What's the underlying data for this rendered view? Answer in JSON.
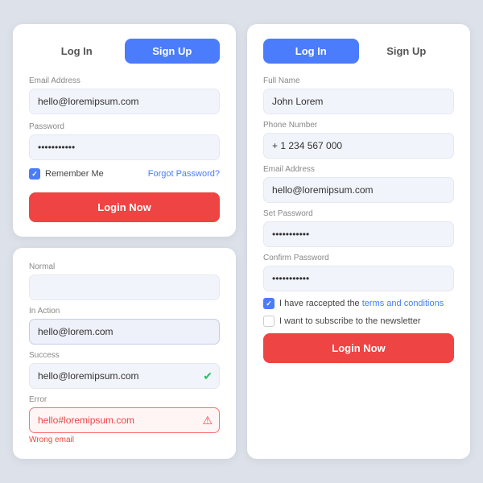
{
  "login_card": {
    "tab_login": "Log In",
    "tab_signup": "Sign Up",
    "email_label": "Email Address",
    "email_value": "hello@loremipsum.com",
    "password_label": "Password",
    "password_value": "••••••••••••",
    "remember_label": "Remember Me",
    "forgot_label": "Forgot Password?",
    "login_button": "Login Now"
  },
  "states_card": {
    "normal_label": "Normal",
    "normal_value": "",
    "inaction_label": "In Action",
    "inaction_value": "hello@lorem.com",
    "success_label": "Success",
    "success_value": "hello@loremipsum.com",
    "error_label": "Error",
    "error_value": "hello#loremipsum.com",
    "error_text": "Wrong email"
  },
  "signup_card": {
    "tab_login": "Log In",
    "tab_signup": "Sign Up",
    "fullname_label": "Full Name",
    "fullname_value": "John Lorem",
    "phone_label": "Phone Number",
    "phone_value": "+ 1 234 567 000",
    "email_label": "Email Address",
    "email_value": "hello@loremipsum.com",
    "setpassword_label": "Set Password",
    "setpassword_value": "••••••••••••",
    "confirmpassword_label": "Confirm Password",
    "confirmpassword_value": "••••••••••••",
    "terms_text1": "I have raccepted the ",
    "terms_link": "terms and conditions",
    "newsletter_label": "I want to subscribe to the newsletter",
    "login_button": "Login Now"
  }
}
